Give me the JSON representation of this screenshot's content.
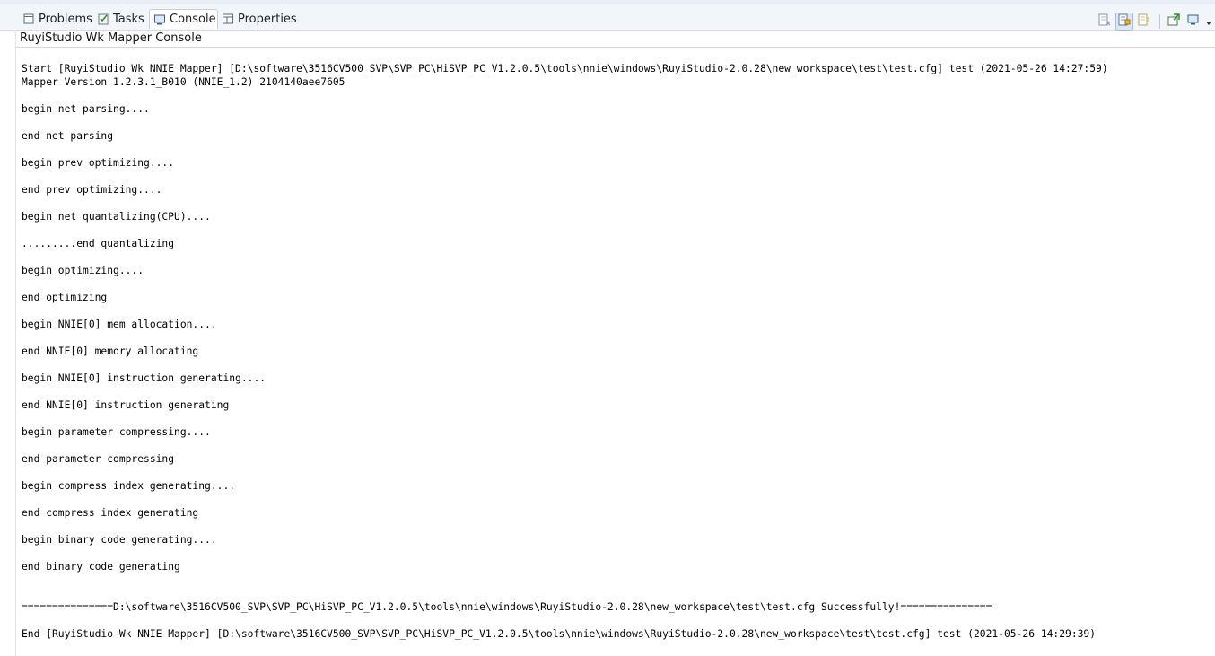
{
  "tabs": [
    {
      "label": "Problems",
      "icon": "problems-icon",
      "active": false
    },
    {
      "label": "Tasks",
      "icon": "tasks-icon",
      "active": false
    },
    {
      "label": "Console",
      "icon": "console-icon",
      "active": true
    },
    {
      "label": "Properties",
      "icon": "properties-icon",
      "active": false
    }
  ],
  "toolbar": {
    "icons": [
      "clear-console-icon",
      "scroll-lock-icon",
      "word-wrap-icon",
      "pin-console-icon",
      "display-console-icon",
      "view-menu-chevron-icon"
    ]
  },
  "console": {
    "title": "RuyiStudio Wk Mapper Console",
    "lines": [
      "Start [RuyiStudio Wk NNIE Mapper] [D:\\software\\3516CV500_SVP\\SVP_PC\\HiSVP_PC_V1.2.0.5\\tools\\nnie\\windows\\RuyiStudio-2.0.28\\new_workspace\\test\\test.cfg] test (2021-05-26 14:27:59)",
      "Mapper Version 1.2.3.1_B010 (NNIE_1.2) 2104140aee7605",
      "",
      "begin net parsing....",
      "",
      "end net parsing",
      "",
      "begin prev optimizing....",
      "",
      "end prev optimizing....",
      "",
      "begin net quantalizing(CPU)....",
      "",
      ".........end quantalizing",
      "",
      "begin optimizing....",
      "",
      "end optimizing",
      "",
      "begin NNIE[0] mem allocation....",
      "",
      "end NNIE[0] memory allocating",
      "",
      "begin NNIE[0] instruction generating....",
      "",
      "end NNIE[0] instruction generating",
      "",
      "begin parameter compressing....",
      "",
      "end parameter compressing",
      "",
      "begin compress index generating....",
      "",
      "end compress index generating",
      "",
      "begin binary code generating....",
      "",
      "end binary code generating",
      "",
      "",
      "===============D:\\software\\3516CV500_SVP\\SVP_PC\\HiSVP_PC_V1.2.0.5\\tools\\nnie\\windows\\RuyiStudio-2.0.28\\new_workspace\\test\\test.cfg Successfully!===============",
      "",
      "End [RuyiStudio Wk NNIE Mapper] [D:\\software\\3516CV500_SVP\\SVP_PC\\HiSVP_PC_V1.2.0.5\\tools\\nnie\\windows\\RuyiStudio-2.0.28\\new_workspace\\test\\test.cfg] test (2021-05-26 14:29:39)"
    ]
  }
}
